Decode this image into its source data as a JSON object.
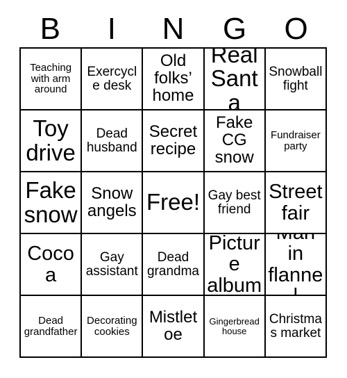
{
  "header": {
    "letters": [
      "B",
      "I",
      "N",
      "G",
      "O"
    ]
  },
  "grid": {
    "rows": 5,
    "columns": 5,
    "free_space": "Free!",
    "cells": [
      {
        "text": "Teaching with arm around",
        "size": "sm"
      },
      {
        "text": "Exercycle desk",
        "size": "md"
      },
      {
        "text": "Old folks’ home",
        "size": "lg"
      },
      {
        "text": "Real Santa",
        "size": "xxl"
      },
      {
        "text": "Snowball fight",
        "size": "md"
      },
      {
        "text": "Toy drive",
        "size": "xxl"
      },
      {
        "text": "Dead husband",
        "size": "md"
      },
      {
        "text": "Secret recipe",
        "size": "lg"
      },
      {
        "text": "Fake CG snow",
        "size": "lg"
      },
      {
        "text": "Fundraiser party",
        "size": "sm"
      },
      {
        "text": "Fake snow",
        "size": "xxl"
      },
      {
        "text": "Snow angels",
        "size": "lg"
      },
      {
        "text": "Free!",
        "size": "xxl"
      },
      {
        "text": "Gay best friend",
        "size": "md"
      },
      {
        "text": "Street fair",
        "size": "xl"
      },
      {
        "text": "Cocoa",
        "size": "xl"
      },
      {
        "text": "Gay assistant",
        "size": "md"
      },
      {
        "text": "Dead grandma",
        "size": "md"
      },
      {
        "text": "Picture album",
        "size": "xl"
      },
      {
        "text": "Man in flannel",
        "size": "xl"
      },
      {
        "text": "Dead grandfather",
        "size": "sm"
      },
      {
        "text": "Decorating cookies",
        "size": "sm"
      },
      {
        "text": "Mistletoe",
        "size": "lg"
      },
      {
        "text": "Gingerbread house",
        "size": "xs"
      },
      {
        "text": "Christmas market",
        "size": "md"
      }
    ]
  },
  "colors": {
    "border": "#000000",
    "background": "#ffffff",
    "text": "#000000"
  }
}
